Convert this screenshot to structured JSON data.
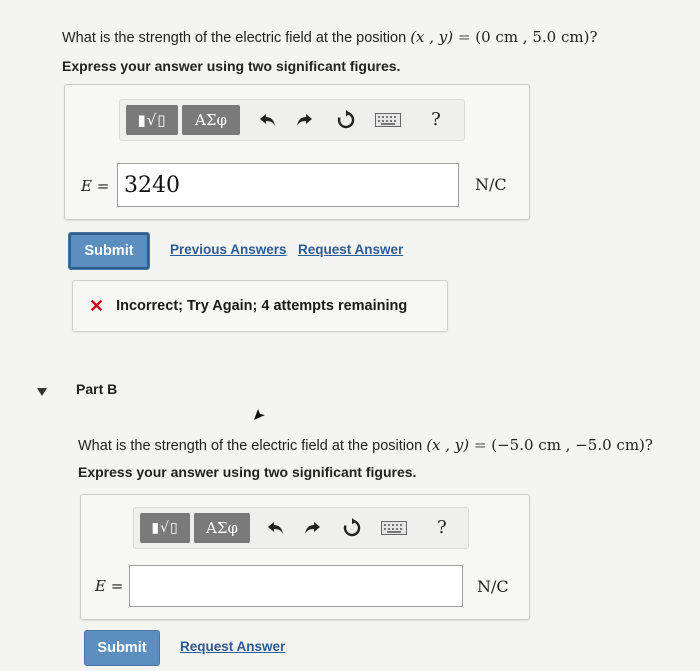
{
  "part_a": {
    "question_prefix": "What is the strength of the electric field at the position ",
    "question_math_vars": "(x , y)",
    "question_math_eq": " = ",
    "question_math_val": "(0 cm , 5.0 cm)?",
    "instruction": "Express your answer using two significant figures.",
    "toolbar": {
      "templates_icon": "sqrt-template-icon",
      "greek_label": "ΑΣφ",
      "undo_icon": "undo-icon",
      "redo_icon": "redo-icon",
      "reset_icon": "reset-icon",
      "keyboard_icon": "keyboard-icon",
      "help_label": "?"
    },
    "variable_label": "E =",
    "answer_value": "3240",
    "unit": "N/C",
    "submit_label": "Submit",
    "previous_answers_label": "Previous Answers",
    "request_answer_label": "Request Answer",
    "feedback": {
      "icon": "x-icon",
      "mark": "✕",
      "text": "Incorrect; Try Again; 4 attempts remaining",
      "color": "#d0021b"
    }
  },
  "part_b": {
    "header": "Part B",
    "question_prefix": "What is the strength of the electric field at the position ",
    "question_math_vars": "(x , y)",
    "question_math_eq": " = ",
    "question_math_val": "(−5.0 cm , −5.0 cm)?",
    "instruction": "Express your answer using two significant figures.",
    "toolbar": {
      "greek_label": "ΑΣφ",
      "help_label": "?"
    },
    "variable_label": "E =",
    "answer_value": "",
    "unit": "N/C",
    "submit_label": "Submit",
    "request_answer_label": "Request Answer"
  },
  "colors": {
    "submit_bg": "#5c8fbf",
    "link": "#2c5b95",
    "error": "#d0021b"
  }
}
